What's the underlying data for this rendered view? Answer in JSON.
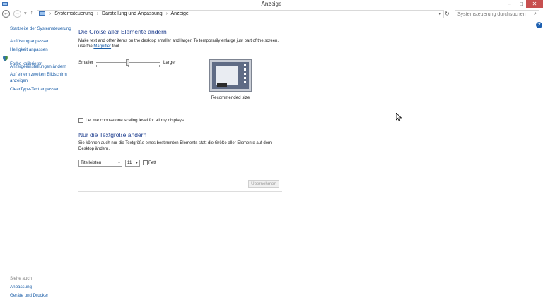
{
  "window": {
    "title": "Anzeige",
    "minimize": "–",
    "maximize": "□",
    "close": "✕"
  },
  "addressbar": {
    "crumbs": [
      "Systemsteuerung",
      "Darstellung und Anpassung",
      "Anzeige"
    ],
    "search_placeholder": "Systemsteuerung durchsuchen"
  },
  "help": "?",
  "sidebar": {
    "home": "Startseite der Systemsteuerung",
    "items": [
      "Auflösung anpassen",
      "Helligkeit anpassen",
      "Farbe kalibrieren",
      "Anzeigeeinstellungen ändern",
      "Auf einem zweiten Bildschirm anzeigen",
      "ClearType-Text anpassen"
    ],
    "see_also_label": "Siehe auch",
    "see_also": [
      "Anpassung",
      "Geräte und Drucker"
    ]
  },
  "main": {
    "heading1": "Die Größe aller Elemente ändern",
    "desc1_a": "Make text and other items on the desktop smaller and larger. To temporarily enlarge just part of the screen, use the ",
    "desc1_link": "Magnifier",
    "desc1_b": " tool.",
    "slider": {
      "min_label": "Smaller",
      "max_label": "Larger",
      "value": 0.5
    },
    "preview_label": "Recommended size",
    "checkbox_label": "Let me choose one scaling level for all my displays",
    "checkbox_checked": false,
    "heading2": "Nur die Textgröße ändern",
    "desc2": "Sie können auch nur die Textgröße eines bestimmten Elements statt die Größe aller Elemente auf dem Desktop ändern.",
    "element_select": "Titelleisten",
    "size_select": "11",
    "bold_label": "Fett",
    "bold_checked": false,
    "apply_label": "Übernehmen"
  },
  "icons": {
    "back": "←",
    "forward": "→",
    "dropdown": "▾",
    "up": "↑",
    "refresh": "↻",
    "search": "⌕"
  },
  "colors": {
    "link": "#1b5ea8",
    "heading": "#1e3e8f",
    "close_button": "#c75050"
  }
}
